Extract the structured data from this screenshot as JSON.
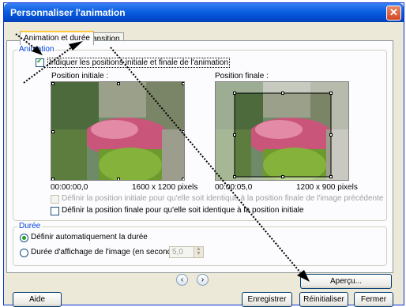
{
  "window": {
    "title": "Personnaliser l'animation",
    "close_glyph": "✕"
  },
  "tabs": [
    {
      "label": "Animation et durée",
      "active": true
    },
    {
      "label": "Transition",
      "active": false
    }
  ],
  "animation": {
    "legend": "Animation",
    "checkbox_label": "Indiquer les positions initiale et finale de l'animation",
    "checkbox_checked": true,
    "initial": {
      "label": "Position initiale :",
      "time": "00:00:00,0",
      "size": "1600 x 1200 pixels"
    },
    "final": {
      "label": "Position finale :",
      "time": "00:00:05,0",
      "size": "1200 x 900 pixels"
    },
    "opt_same_initial": "Définir la position initiale pour qu'elle soit identique à la position finale de l'image précédente",
    "opt_same_final": "Définir la position finale pour qu'elle soit identique à la position initiale"
  },
  "duration": {
    "legend": "Durée",
    "auto_label": "Définir automatiquement la durée",
    "manual_label": "Durée d'affichage de l'image (en secondes)",
    "value": "5,0"
  },
  "nav": {
    "prev": "‹",
    "next": "›"
  },
  "buttons": {
    "preview": "Aperçu...",
    "help": "Aide",
    "save": "Enregistrer",
    "reset": "Réinitialiser",
    "close": "Fermer"
  },
  "colors": {
    "title_bar": "#0a5fe0",
    "legend": "#0046d5",
    "check": "#21a121"
  }
}
